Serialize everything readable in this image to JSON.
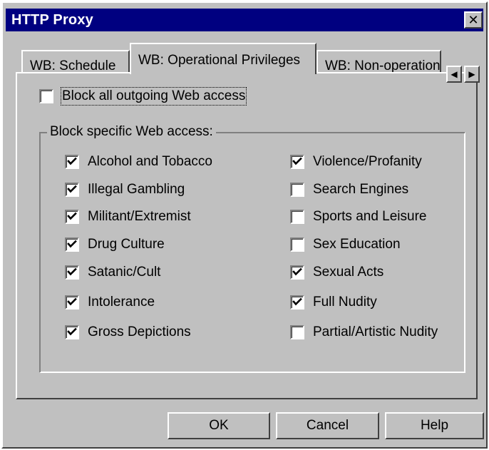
{
  "window": {
    "title": "HTTP Proxy",
    "close_glyph": "✕"
  },
  "tabs": [
    {
      "label": "WB: Schedule",
      "selected": false
    },
    {
      "label": "WB: Operational Privileges",
      "selected": true
    },
    {
      "label": "WB: Non-operation",
      "selected": false
    }
  ],
  "tab_scroll": {
    "left_glyph": "◀",
    "right_glyph": "▶"
  },
  "block_all": {
    "label": "Block all outgoing Web access",
    "checked": false
  },
  "group": {
    "label": "Block specific Web access:",
    "left_column": [
      {
        "label": "Alcohol and Tobacco",
        "checked": true
      },
      {
        "label": "Illegal Gambling",
        "checked": true
      },
      {
        "label": "Militant/Extremist",
        "checked": true
      },
      {
        "label": "Drug Culture",
        "checked": true
      },
      {
        "label": "Satanic/Cult",
        "checked": true
      },
      {
        "label": "Intolerance",
        "checked": true
      },
      {
        "label": "Gross Depictions",
        "checked": true
      }
    ],
    "right_column": [
      {
        "label": "Violence/Profanity",
        "checked": true
      },
      {
        "label": "Search Engines",
        "checked": false
      },
      {
        "label": "Sports and Leisure",
        "checked": false
      },
      {
        "label": "Sex Education",
        "checked": false
      },
      {
        "label": "Sexual Acts",
        "checked": true
      },
      {
        "label": "Full Nudity",
        "checked": true
      },
      {
        "label": "Partial/Artistic Nudity",
        "checked": false
      }
    ]
  },
  "buttons": {
    "ok": "OK",
    "cancel": "Cancel",
    "help": "Help"
  },
  "colors": {
    "titlebar": "#000080",
    "face": "#c0c0c0"
  }
}
